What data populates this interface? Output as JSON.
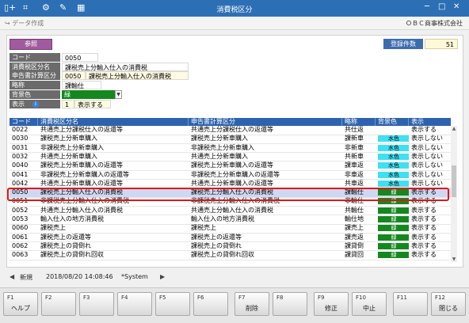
{
  "window": {
    "title": "消費税区分"
  },
  "subbar": {
    "data_menu": "データ作成",
    "company": "ＯＢＣ商事株式会社"
  },
  "ref_button": "参照",
  "reg_count": {
    "label": "登録件数",
    "value": "51"
  },
  "form": {
    "code_label": "コード",
    "code_value": "0050",
    "name_label": "消費税区分名",
    "name_value": "課税売上分輸入仕入の消費税",
    "report_label": "申告書計算区分",
    "report_code": "0050",
    "report_name": "課税売上分輸入仕入の消費税",
    "abbr_label": "略称",
    "abbr_value": "課輸仕",
    "bg_label": "背景色",
    "bg_value": "緑",
    "display_label": "表示",
    "display_code": "1",
    "display_value": "表示する"
  },
  "table": {
    "headers": [
      "コード",
      "消費税区分名",
      "申告書計算区分",
      "略称",
      "背景色",
      "表示"
    ],
    "rows": [
      {
        "code": "0022",
        "name": "共通売上分課税仕入の返還等",
        "report": "共通売上分課税仕入の返還等",
        "abbr": "共仕返",
        "color": "",
        "display": "表示する"
      },
      {
        "code": "0030",
        "name": "課税売上分新車購入",
        "report": "課税売上分新車購入",
        "abbr": "課新車",
        "color": "水色",
        "display": "表示しない"
      },
      {
        "code": "0031",
        "name": "非課税売上分新車購入",
        "report": "非課税売上分新車購入",
        "abbr": "非新車",
        "color": "水色",
        "display": "表示しない"
      },
      {
        "code": "0032",
        "name": "共通売上分新車購入",
        "report": "共通売上分新車購入",
        "abbr": "共新車",
        "color": "水色",
        "display": "表示しない"
      },
      {
        "code": "0040",
        "name": "課税売上分新車購入の返還等",
        "report": "課税売上分新車購入の返還等",
        "abbr": "課車返",
        "color": "水色",
        "display": "表示しない"
      },
      {
        "code": "0041",
        "name": "非課税売上分新車購入の返還等",
        "report": "非課税売上分新車購入の返還等",
        "abbr": "非車返",
        "color": "水色",
        "display": "表示しない"
      },
      {
        "code": "0042",
        "name": "共通売上分新車購入の返還等",
        "report": "共通売上分新車購入の返還等",
        "abbr": "共車返",
        "color": "水色",
        "display": "表示しない"
      },
      {
        "code": "0050",
        "name": "課税売上分輸入仕入の消費税",
        "report": "課税売上分輸入仕入の消費税",
        "abbr": "課輸仕",
        "color": "緑",
        "display": "表示する"
      },
      {
        "code": "0051",
        "name": "非課税売上分輸入仕入の消費税",
        "report": "非課税売上分輸入仕入の消費税",
        "abbr": "非輸仕",
        "color": "緑",
        "display": "表示する"
      },
      {
        "code": "0052",
        "name": "共通売上分輸入仕入の消費税",
        "report": "共通売上分輸入仕入の消費税",
        "abbr": "共輸仕",
        "color": "緑",
        "display": "表示する"
      },
      {
        "code": "0053",
        "name": "輸入仕入の地方消費税",
        "report": "輸入仕入の地方消費税",
        "abbr": "輸仕地",
        "color": "緑",
        "display": "表示する"
      },
      {
        "code": "0060",
        "name": "課税売上",
        "report": "課税売上",
        "abbr": "課売上",
        "color": "緑",
        "display": "表示する"
      },
      {
        "code": "0061",
        "name": "課税売上の返還等",
        "report": "課税売上の返還等",
        "abbr": "課売返",
        "color": "緑",
        "display": "表示する"
      },
      {
        "code": "0062",
        "name": "課税売上の貸倒れ",
        "report": "課税売上の貸倒れ",
        "abbr": "課貸倒",
        "color": "緑",
        "display": "表示する"
      },
      {
        "code": "0063",
        "name": "課税売上の貸倒れ回収",
        "report": "課税売上の貸倒れ回収",
        "abbr": "課貸回",
        "color": "緑",
        "display": "表示する"
      }
    ]
  },
  "status": {
    "mode": "新規",
    "timestamp": "2018/08/20 14:08:46",
    "user": "*System"
  },
  "fkeys": [
    {
      "num": "F1",
      "label": "ヘルプ"
    },
    {
      "num": "F2",
      "label": ""
    },
    {
      "num": "F3",
      "label": ""
    },
    {
      "num": "F4",
      "label": ""
    },
    {
      "num": "F5",
      "label": ""
    },
    {
      "num": "F6",
      "label": ""
    },
    {
      "num": "F7",
      "label": "削除"
    },
    {
      "num": "F8",
      "label": ""
    },
    {
      "num": "F9",
      "label": "修正"
    },
    {
      "num": "F10",
      "label": "中止"
    },
    {
      "num": "F11",
      "label": ""
    },
    {
      "num": "F12",
      "label": "閉じる"
    }
  ],
  "colors": {
    "titlebar": "#2d6fb4",
    "header": "#2d63ae",
    "green": "#14881e",
    "cyan": "#3fe0f2",
    "highlight": "#e01616"
  }
}
